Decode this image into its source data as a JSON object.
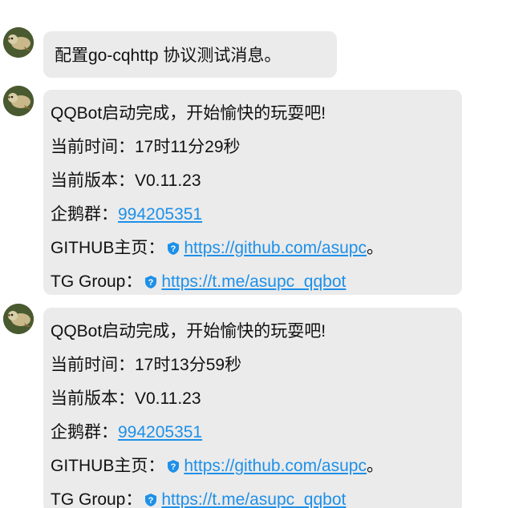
{
  "messages": [
    {
      "lines": [
        {
          "text": "配置go-cqhttp 协议测试消息。"
        }
      ]
    },
    {
      "lines": [
        {
          "text": "QQBot启动完成，开始愉快的玩耍吧!"
        },
        {
          "text": "当前时间：17时11分29秒"
        },
        {
          "text": "当前版本：V0.11.23"
        },
        {
          "label": "企鹅群：",
          "link": "994205351"
        },
        {
          "label": "GITHUB主页：",
          "link": "https://github.com/asupc",
          "suffix": "。"
        },
        {
          "label": "TG Group：",
          "link": "https://t.me/asupc_qqbot"
        }
      ]
    },
    {
      "lines": [
        {
          "text": "QQBot启动完成，开始愉快的玩耍吧!"
        },
        {
          "text": "当前时间：17时13分59秒"
        },
        {
          "text": "当前版本：V0.11.23"
        },
        {
          "label": "企鹅群：",
          "link": "994205351"
        },
        {
          "label": "GITHUB主页：",
          "link": "https://github.com/asupc",
          "suffix": "。"
        },
        {
          "label": "TG Group：",
          "link": "https://t.me/asupc_qqbot"
        }
      ]
    }
  ],
  "colors": {
    "bubble": "#ebebeb",
    "link": "#1e90e8",
    "text": "#111111"
  },
  "icons": {
    "avatar": "bird-avatar-icon",
    "link": "shield-link-icon"
  }
}
